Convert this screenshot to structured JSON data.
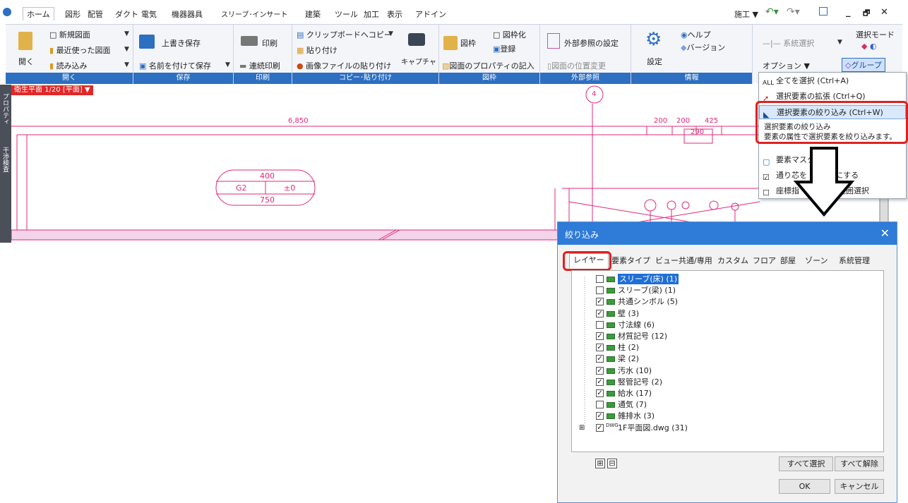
{
  "menubar": {
    "tabs": [
      "ホーム",
      "図形",
      "配管",
      "ダクト",
      "電気",
      "機器器具",
      "スリーブ･インサート",
      "建築",
      "ツール",
      "加工",
      "表示",
      "アドイン"
    ],
    "right": {
      "mode": "施工 ▼",
      "min": "_",
      "restore": "🗗",
      "close": "✕"
    }
  },
  "ribbon": {
    "open": {
      "label": "開く",
      "big": "開く",
      "new": "新規図面",
      "recent": "最近使った図面",
      "load": "読み込み"
    },
    "save": {
      "label": "保存",
      "overwrite": "上書き保存",
      "save_as": "名前を付けて保存"
    },
    "print": {
      "label": "印刷",
      "print": "印刷",
      "continuous": "連続印刷"
    },
    "copy": {
      "label": "コピー･貼り付け",
      "clip_copy": "クリップボードへコピー",
      "paste": "貼り付け",
      "image_paste": "画像ファイルの貼り付け",
      "capture": "キャプチャ"
    },
    "frame": {
      "label": "図枠",
      "frame": "図枠",
      "to_frame": "図枠化",
      "register": "登録",
      "props": "図面のプロパティの記入"
    },
    "xref": {
      "label": "外部参照",
      "settings": "外部参照の設定",
      "position": "図面の位置変更"
    },
    "info": {
      "label": "情報",
      "settings": "設定",
      "help": "ヘルプ",
      "version": "バージョン"
    },
    "select": {
      "system": "系統選択",
      "mode": "選択モード",
      "options": "オプション",
      "group": "グループ"
    }
  },
  "view": {
    "title": "衛生平面 1/20 [平面]",
    "side_tabs": [
      "プロパティ",
      "干渉検査"
    ],
    "dims": {
      "d6850": "6,850",
      "d200a": "200",
      "d200b": "200",
      "d425": "425",
      "d290": "290"
    },
    "marker": "4",
    "tag": {
      "top": "400",
      "left": "G2",
      "right": "±0",
      "bottom": "750"
    }
  },
  "context_menu": {
    "items": [
      {
        "label": "全てを選択 (Ctrl+A)"
      },
      {
        "label": "選択要素の拡張 (Ctrl+Q)"
      },
      {
        "label": "選択要素の絞り込み (Ctrl+W)"
      },
      {
        "label": "要素マスク"
      },
      {
        "label": "通り芯を"
      },
      {
        "label": "座標指"
      }
    ],
    "items_tail": {
      "through": "にする",
      "coord": "で範囲選択"
    },
    "tooltip": {
      "title": "選択要素の絞り込み",
      "desc": "要素の属性で選択要素を絞り込みます。"
    }
  },
  "dialog": {
    "title": "絞り込み",
    "close": "✕",
    "tabs": [
      "レイヤー",
      "要素タイプ",
      "ビュー共通/専用",
      "カスタム",
      "フロア",
      "部屋",
      "ゾーン",
      "系統管理"
    ],
    "layers": [
      {
        "label": "スリーブ(床) (1)",
        "checked": false
      },
      {
        "label": "スリーブ(梁) (1)",
        "checked": false
      },
      {
        "label": "共通シンボル (5)",
        "checked": true
      },
      {
        "label": "壁 (3)",
        "checked": true
      },
      {
        "label": "寸法線 (6)",
        "checked": false
      },
      {
        "label": "材質記号 (12)",
        "checked": true
      },
      {
        "label": "柱 (2)",
        "checked": true
      },
      {
        "label": "梁 (2)",
        "checked": true
      },
      {
        "label": "汚水 (10)",
        "checked": true
      },
      {
        "label": "竪管記号 (2)",
        "checked": true
      },
      {
        "label": "給水 (17)",
        "checked": true
      },
      {
        "label": "通気 (7)",
        "checked": false
      },
      {
        "label": "雑排水 (3)",
        "checked": true
      },
      {
        "label": "1F平面図.dwg (31)",
        "checked": true
      }
    ],
    "dwg_badge": "DWG",
    "expand": "⊞",
    "collapse": "⊟",
    "select_all": "すべて選択",
    "deselect_all": "すべて解除",
    "ok": "OK",
    "cancel": "キャンセル"
  }
}
